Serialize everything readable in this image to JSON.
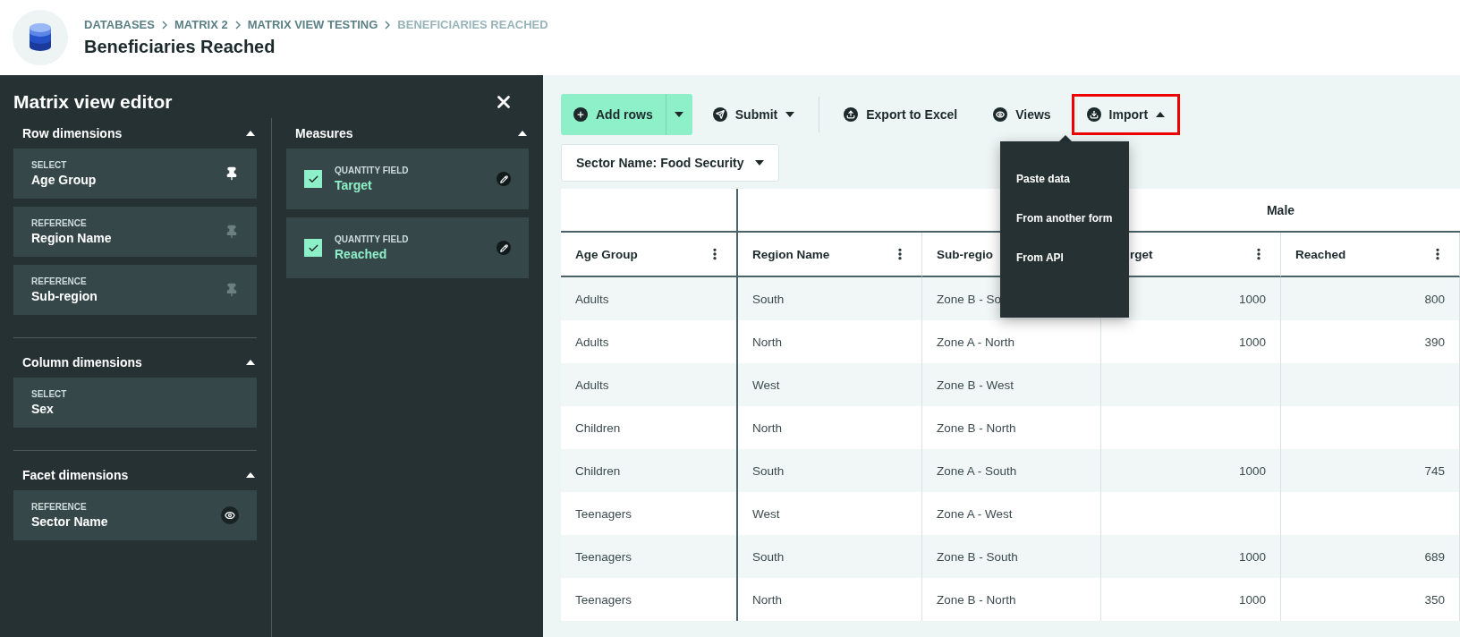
{
  "breadcrumb": [
    {
      "label": "DATABASES",
      "current": false
    },
    {
      "label": "MATRIX 2",
      "current": false
    },
    {
      "label": "MATRIX VIEW TESTING",
      "current": false
    },
    {
      "label": "BENEFICIARIES REACHED",
      "current": true
    }
  ],
  "page_title": "Beneficiaries Reached",
  "editor": {
    "title": "Matrix view editor",
    "sections": [
      {
        "title": "Row dimensions",
        "expanded": true,
        "items": [
          {
            "type": "SELECT",
            "name": "Age Group",
            "kind": "pinnable",
            "active": true
          },
          {
            "type": "REFERENCE",
            "name": "Region Name",
            "kind": "pinnable",
            "active": false
          },
          {
            "type": "REFERENCE",
            "name": "Sub-region",
            "kind": "pinnable",
            "active": false
          }
        ]
      },
      {
        "title": "Column dimensions",
        "expanded": true,
        "items": [
          {
            "type": "SELECT",
            "name": "Sex",
            "kind": "plain"
          }
        ]
      },
      {
        "title": "Facet dimensions",
        "expanded": true,
        "items": [
          {
            "type": "REFERENCE",
            "name": "Sector Name",
            "kind": "viewable",
            "active": true
          }
        ]
      }
    ],
    "measures": {
      "title": "Measures",
      "expanded": true,
      "items": [
        {
          "type": "QUANTITY FIELD",
          "name": "Target",
          "checked": true
        },
        {
          "type": "QUANTITY FIELD",
          "name": "Reached",
          "checked": true
        }
      ]
    }
  },
  "toolbar": [
    {
      "kind": "split",
      "label": "Add rows"
    },
    {
      "kind": "menu",
      "label": "Submit",
      "expanded": false,
      "highlighted": false
    },
    {
      "kind": "divider"
    },
    {
      "kind": "plain",
      "label": "Export to Excel"
    },
    {
      "kind": "plain",
      "label": "Views"
    },
    {
      "kind": "menu",
      "label": "Import",
      "expanded": true,
      "highlighted": true
    }
  ],
  "import_menu": [
    "Paste data",
    "From another form",
    "From API"
  ],
  "filter": "Sector Name: Food Security",
  "table": {
    "group_header": "Male",
    "columns": [
      "Age Group",
      "Region Name",
      "Sub-regio",
      "rget",
      "Reached"
    ],
    "rows": [
      [
        "Adults",
        "South",
        "Zone B - So",
        "1000",
        "800"
      ],
      [
        "Adults",
        "North",
        "Zone A - North",
        "1000",
        "390"
      ],
      [
        "Adults",
        "West",
        "Zone B - West",
        null,
        null
      ],
      [
        "Children",
        "North",
        "Zone B - North",
        null,
        null
      ],
      [
        "Children",
        "South",
        "Zone A - South",
        "1000",
        "745"
      ],
      [
        "Teenagers",
        "West",
        "Zone A - West",
        null,
        null
      ],
      [
        "Teenagers",
        "South",
        "Zone B - South",
        "1000",
        "689"
      ],
      [
        "Teenagers",
        "North",
        "Zone B - North",
        "1000",
        "350"
      ]
    ]
  }
}
